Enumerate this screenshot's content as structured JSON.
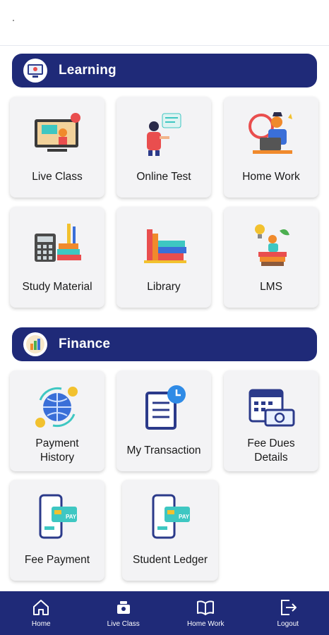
{
  "sections": {
    "learning": {
      "title": "Learning",
      "items": [
        {
          "label": "Live Class",
          "icon": "live-class-icon"
        },
        {
          "label": "Online Test",
          "icon": "online-test-icon"
        },
        {
          "label": "Home Work",
          "icon": "home-work-icon"
        },
        {
          "label": "Study Material",
          "icon": "study-material-icon"
        },
        {
          "label": "Library",
          "icon": "library-icon"
        },
        {
          "label": "LMS",
          "icon": "lms-icon"
        }
      ]
    },
    "finance": {
      "title": "Finance",
      "items": [
        {
          "label": "Payment History",
          "icon": "payment-history-icon"
        },
        {
          "label": "My Transaction",
          "icon": "transaction-icon"
        },
        {
          "label": "Fee Dues Details",
          "icon": "fee-dues-icon"
        },
        {
          "label": "Fee Payment",
          "icon": "fee-payment-icon"
        },
        {
          "label": "Student Ledger",
          "icon": "student-ledger-icon"
        }
      ]
    }
  },
  "bottom_nav": [
    {
      "label": "Home",
      "icon": "home-icon"
    },
    {
      "label": "Live Class",
      "icon": "live-class-icon"
    },
    {
      "label": "Home Work",
      "icon": "book-icon"
    },
    {
      "label": "Logout",
      "icon": "logout-icon"
    }
  ],
  "colors": {
    "primary": "#1f2a78",
    "card": "#f3f3f5",
    "accent_teal": "#3ec7c2",
    "accent_orange": "#f08a2c"
  }
}
